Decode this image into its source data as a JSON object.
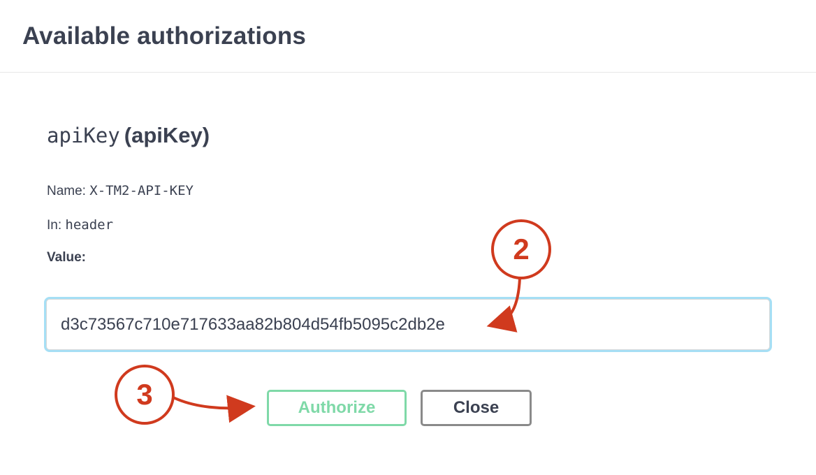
{
  "modal": {
    "title": "Available authorizations"
  },
  "auth": {
    "scheme_name_mono": "apiKey",
    "scheme_type": "(apiKey)",
    "name_label": "Name:",
    "name_value": "X-TM2-API-KEY",
    "in_label": "In:",
    "in_value": "header",
    "value_label": "Value:",
    "value_input": "d3c73567c710e717633aa82b804d54fb5095c2db2e"
  },
  "buttons": {
    "authorize_label": "Authorize",
    "close_label": "Close"
  },
  "annotations": {
    "step_input": "2",
    "step_authorize": "3"
  },
  "colors": {
    "text": "#3b4151",
    "authorize_green": "#7fd9a8",
    "annotation_red": "#d03a1e",
    "input_focus": "#a6dff5"
  }
}
